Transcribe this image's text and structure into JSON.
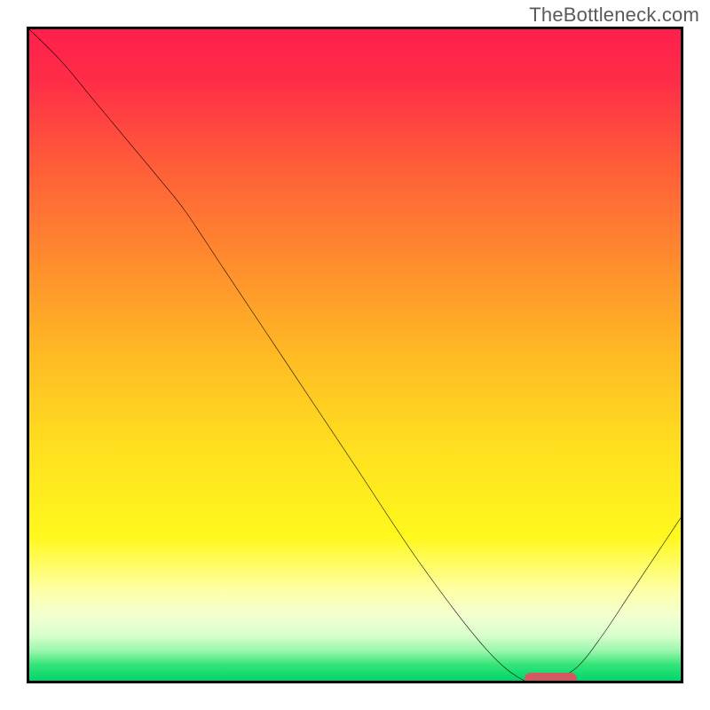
{
  "watermark": "TheBottleneck.com",
  "chart_data": {
    "type": "line",
    "title": "",
    "xlabel": "",
    "ylabel": "",
    "xlim": [
      0,
      100
    ],
    "ylim": [
      0,
      100
    ],
    "grid": false,
    "series": [
      {
        "name": "curve",
        "x": [
          0,
          5,
          10,
          15,
          20,
          24,
          30,
          40,
          50,
          60,
          70,
          76,
          80,
          84,
          88,
          92,
          96,
          100
        ],
        "y": [
          100,
          95,
          89,
          83,
          77,
          72,
          63,
          48,
          33,
          18,
          5,
          0,
          0,
          2,
          7,
          13,
          19,
          25
        ]
      }
    ],
    "marker": {
      "x_start": 76,
      "x_end": 84,
      "y": 0,
      "color": "#d25a5f"
    },
    "gradient_stops": [
      {
        "pos": 0.0,
        "color": "#ff1f4c"
      },
      {
        "pos": 0.08,
        "color": "#ff2d47"
      },
      {
        "pos": 0.2,
        "color": "#ff5a3a"
      },
      {
        "pos": 0.35,
        "color": "#ff8a2e"
      },
      {
        "pos": 0.5,
        "color": "#ffba24"
      },
      {
        "pos": 0.65,
        "color": "#ffe11f"
      },
      {
        "pos": 0.78,
        "color": "#fff81e"
      },
      {
        "pos": 0.86,
        "color": "#feffa5"
      },
      {
        "pos": 0.9,
        "color": "#f3ffd0"
      },
      {
        "pos": 0.93,
        "color": "#d9ffcd"
      },
      {
        "pos": 0.955,
        "color": "#97f6ab"
      },
      {
        "pos": 0.975,
        "color": "#35e578"
      },
      {
        "pos": 1.0,
        "color": "#00d56a"
      }
    ]
  }
}
